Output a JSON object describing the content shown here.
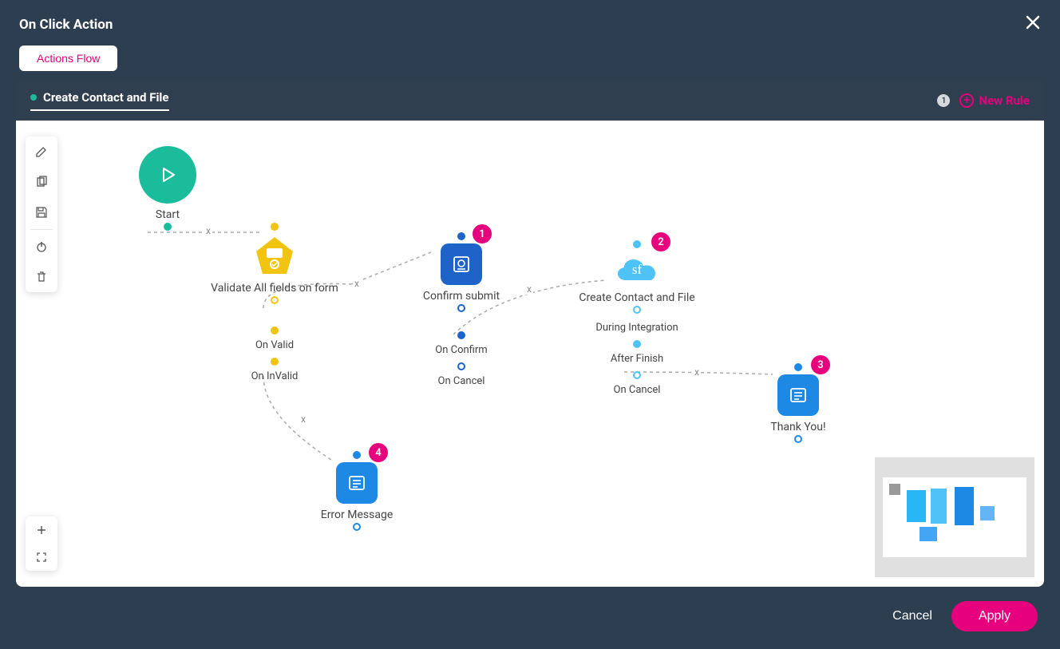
{
  "modal": {
    "title": "On Click Action",
    "tab_label": "Actions Flow"
  },
  "rule_header": {
    "title": "Create Contact and File",
    "badge": "1",
    "new_rule_label": "New Rule"
  },
  "nodes": {
    "start": {
      "label": "Start"
    },
    "validate": {
      "label": "Validate All fields on form",
      "out_valid": "On Valid",
      "out_invalid": "On InValid"
    },
    "confirm": {
      "label": "Confirm submit",
      "badge": "1",
      "out_confirm": "On Confirm",
      "out_cancel": "On Cancel"
    },
    "create": {
      "label": "Create Contact and File",
      "badge": "2",
      "sf_label": "sf",
      "out_during": "During Integration",
      "out_after": "After Finish",
      "out_cancel": "On Cancel"
    },
    "thankyou": {
      "label": "Thank You!",
      "badge": "3"
    },
    "error": {
      "label": "Error Message",
      "badge": "4"
    }
  },
  "colors": {
    "teal": "#1abc9c",
    "yellow": "#f1c40f",
    "blue_dark": "#1e64c8",
    "blue_mid": "#1e88e5",
    "blue_light": "#29b6f6",
    "sky": "#4fc3f7",
    "magenta": "#e6007e"
  },
  "footer": {
    "cancel": "Cancel",
    "apply": "Apply"
  },
  "link_delete_char": "x"
}
